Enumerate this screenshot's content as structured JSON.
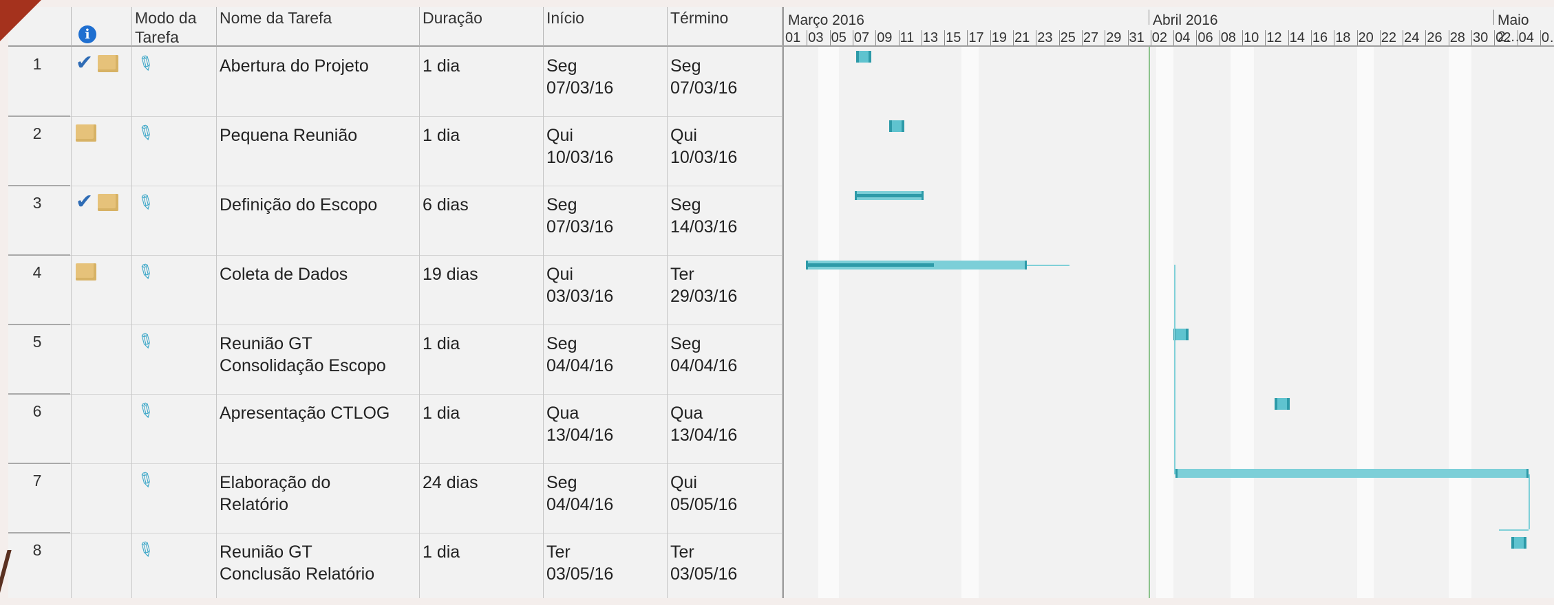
{
  "headers": {
    "mode": "Modo da\nTarefa",
    "name": "Nome da Tarefa",
    "duration": "Duração",
    "start": "Início",
    "finish": "Término"
  },
  "timeline": {
    "month_march": "Março 2016",
    "month_april": "Abril 2016",
    "month_may": "Maio 2…",
    "days": [
      "01",
      "03",
      "05",
      "07",
      "09",
      "11",
      "13",
      "15",
      "17",
      "19",
      "21",
      "23",
      "25",
      "27",
      "29",
      "31",
      "02",
      "04",
      "06",
      "08",
      "10",
      "12",
      "14",
      "16",
      "18",
      "20",
      "22",
      "24",
      "26",
      "28",
      "30",
      "02",
      "04",
      "0…"
    ]
  },
  "tasks": [
    {
      "id": "1",
      "name": "Abertura do Projeto",
      "duration": "1 dia",
      "start": "Seg\n07/03/16",
      "finish": "Seg\n07/03/16",
      "complete": true,
      "note": true
    },
    {
      "id": "2",
      "name": "Pequena Reunião",
      "duration": "1 dia",
      "start": "Qui\n10/03/16",
      "finish": "Qui\n10/03/16",
      "complete": false,
      "note": true
    },
    {
      "id": "3",
      "name": "Definição do Escopo",
      "duration": "6 dias",
      "start": "Seg\n07/03/16",
      "finish": "Seg\n14/03/16",
      "complete": true,
      "note": true
    },
    {
      "id": "4",
      "name": "Coleta de Dados",
      "duration": "19 dias",
      "start": "Qui\n03/03/16",
      "finish": "Ter\n29/03/16",
      "complete": false,
      "note": true
    },
    {
      "id": "5",
      "name": "Reunião GT\nConsolidação Escopo",
      "duration": "1 dia",
      "start": "Seg\n04/04/16",
      "finish": "Seg\n04/04/16",
      "complete": false,
      "note": false
    },
    {
      "id": "6",
      "name": "Apresentação CTLOG",
      "duration": "1 dia",
      "start": "Qua\n13/04/16",
      "finish": "Qua\n13/04/16",
      "complete": false,
      "note": false
    },
    {
      "id": "7",
      "name": "Elaboração do\nRelatório",
      "duration": "24 dias",
      "start": "Seg\n04/04/16",
      "finish": "Qui\n05/05/16",
      "complete": false,
      "note": false
    },
    {
      "id": "8",
      "name": "Reunião GT\nConclusão Relatório",
      "duration": "1 dia",
      "start": "Ter\n03/05/16",
      "finish": "Ter\n03/05/16",
      "complete": false,
      "note": false
    }
  ],
  "colors": {
    "bar": "#7ccfd8",
    "bar_edge": "#2d9aa8",
    "today_line": "#8cc28c",
    "accent": "#a5321d"
  }
}
